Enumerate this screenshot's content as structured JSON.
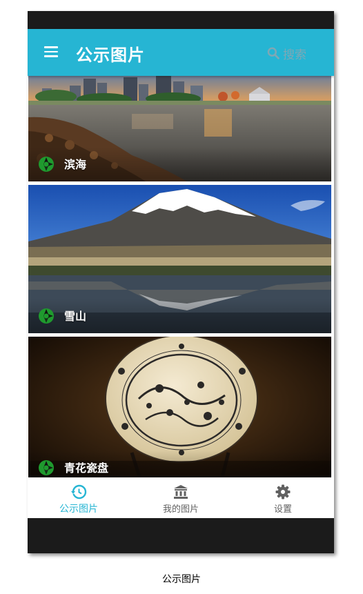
{
  "app_bar": {
    "title": "公示图片",
    "search_label": "搜索",
    "menu_icon": "hamburger-menu-icon",
    "search_icon": "search-icon",
    "background_color": "#26b5d3"
  },
  "cards": [
    {
      "caption": "滨海",
      "scene": "coastal city skyline at sunset with rocky shore",
      "icon": "aperture-icon"
    },
    {
      "caption": "雪山",
      "scene": "snow-capped mountain reflected in lake",
      "icon": "aperture-icon"
    },
    {
      "caption": "青花瓷盘",
      "scene": "blue and white porcelain plate on display stand",
      "icon": "aperture-icon"
    }
  ],
  "bottom_nav": {
    "items": [
      {
        "label": "公示图片",
        "icon": "history-icon",
        "active": true
      },
      {
        "label": "我的图片",
        "icon": "bank-icon",
        "active": false
      },
      {
        "label": "设置",
        "icon": "gear-icon",
        "active": false
      }
    ],
    "active_color": "#26b5d3",
    "inactive_color": "#616161"
  },
  "figure_caption": "公示图片"
}
